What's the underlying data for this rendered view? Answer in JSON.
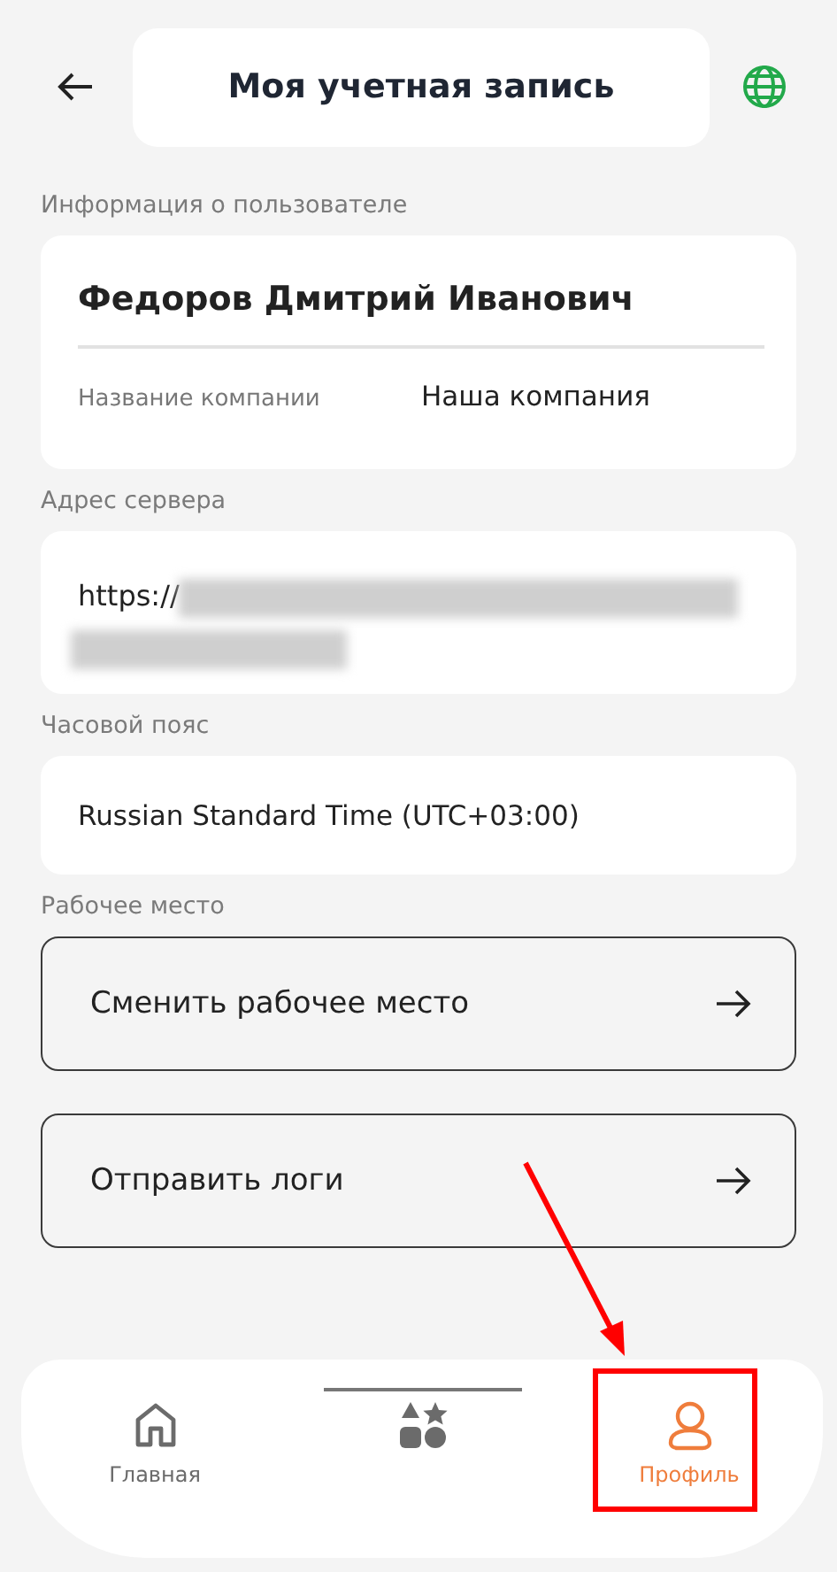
{
  "header": {
    "title": "Моя учетная запись"
  },
  "user_info": {
    "label": "Информация о пользователе",
    "name": "Федоров Дмитрий Иванович",
    "company_label": "Название компании",
    "company": "Наша компания"
  },
  "server": {
    "label": "Адрес сервера",
    "value": "https://",
    "redacted": true
  },
  "timezone": {
    "label": "Часовой пояс",
    "value": "Russian Standard Time (UTC+03:00)"
  },
  "workplace": {
    "label": "Рабочее место",
    "actions": [
      {
        "label": "Сменить рабочее место"
      },
      {
        "label": "Отправить логи"
      }
    ]
  },
  "nav": [
    {
      "kind": "home",
      "label": "Главная",
      "selected": false
    },
    {
      "kind": "catalog",
      "selected": false
    },
    {
      "kind": "profile",
      "label": "Профиль",
      "selected": true
    }
  ],
  "annotation": {
    "highlight": true
  }
}
